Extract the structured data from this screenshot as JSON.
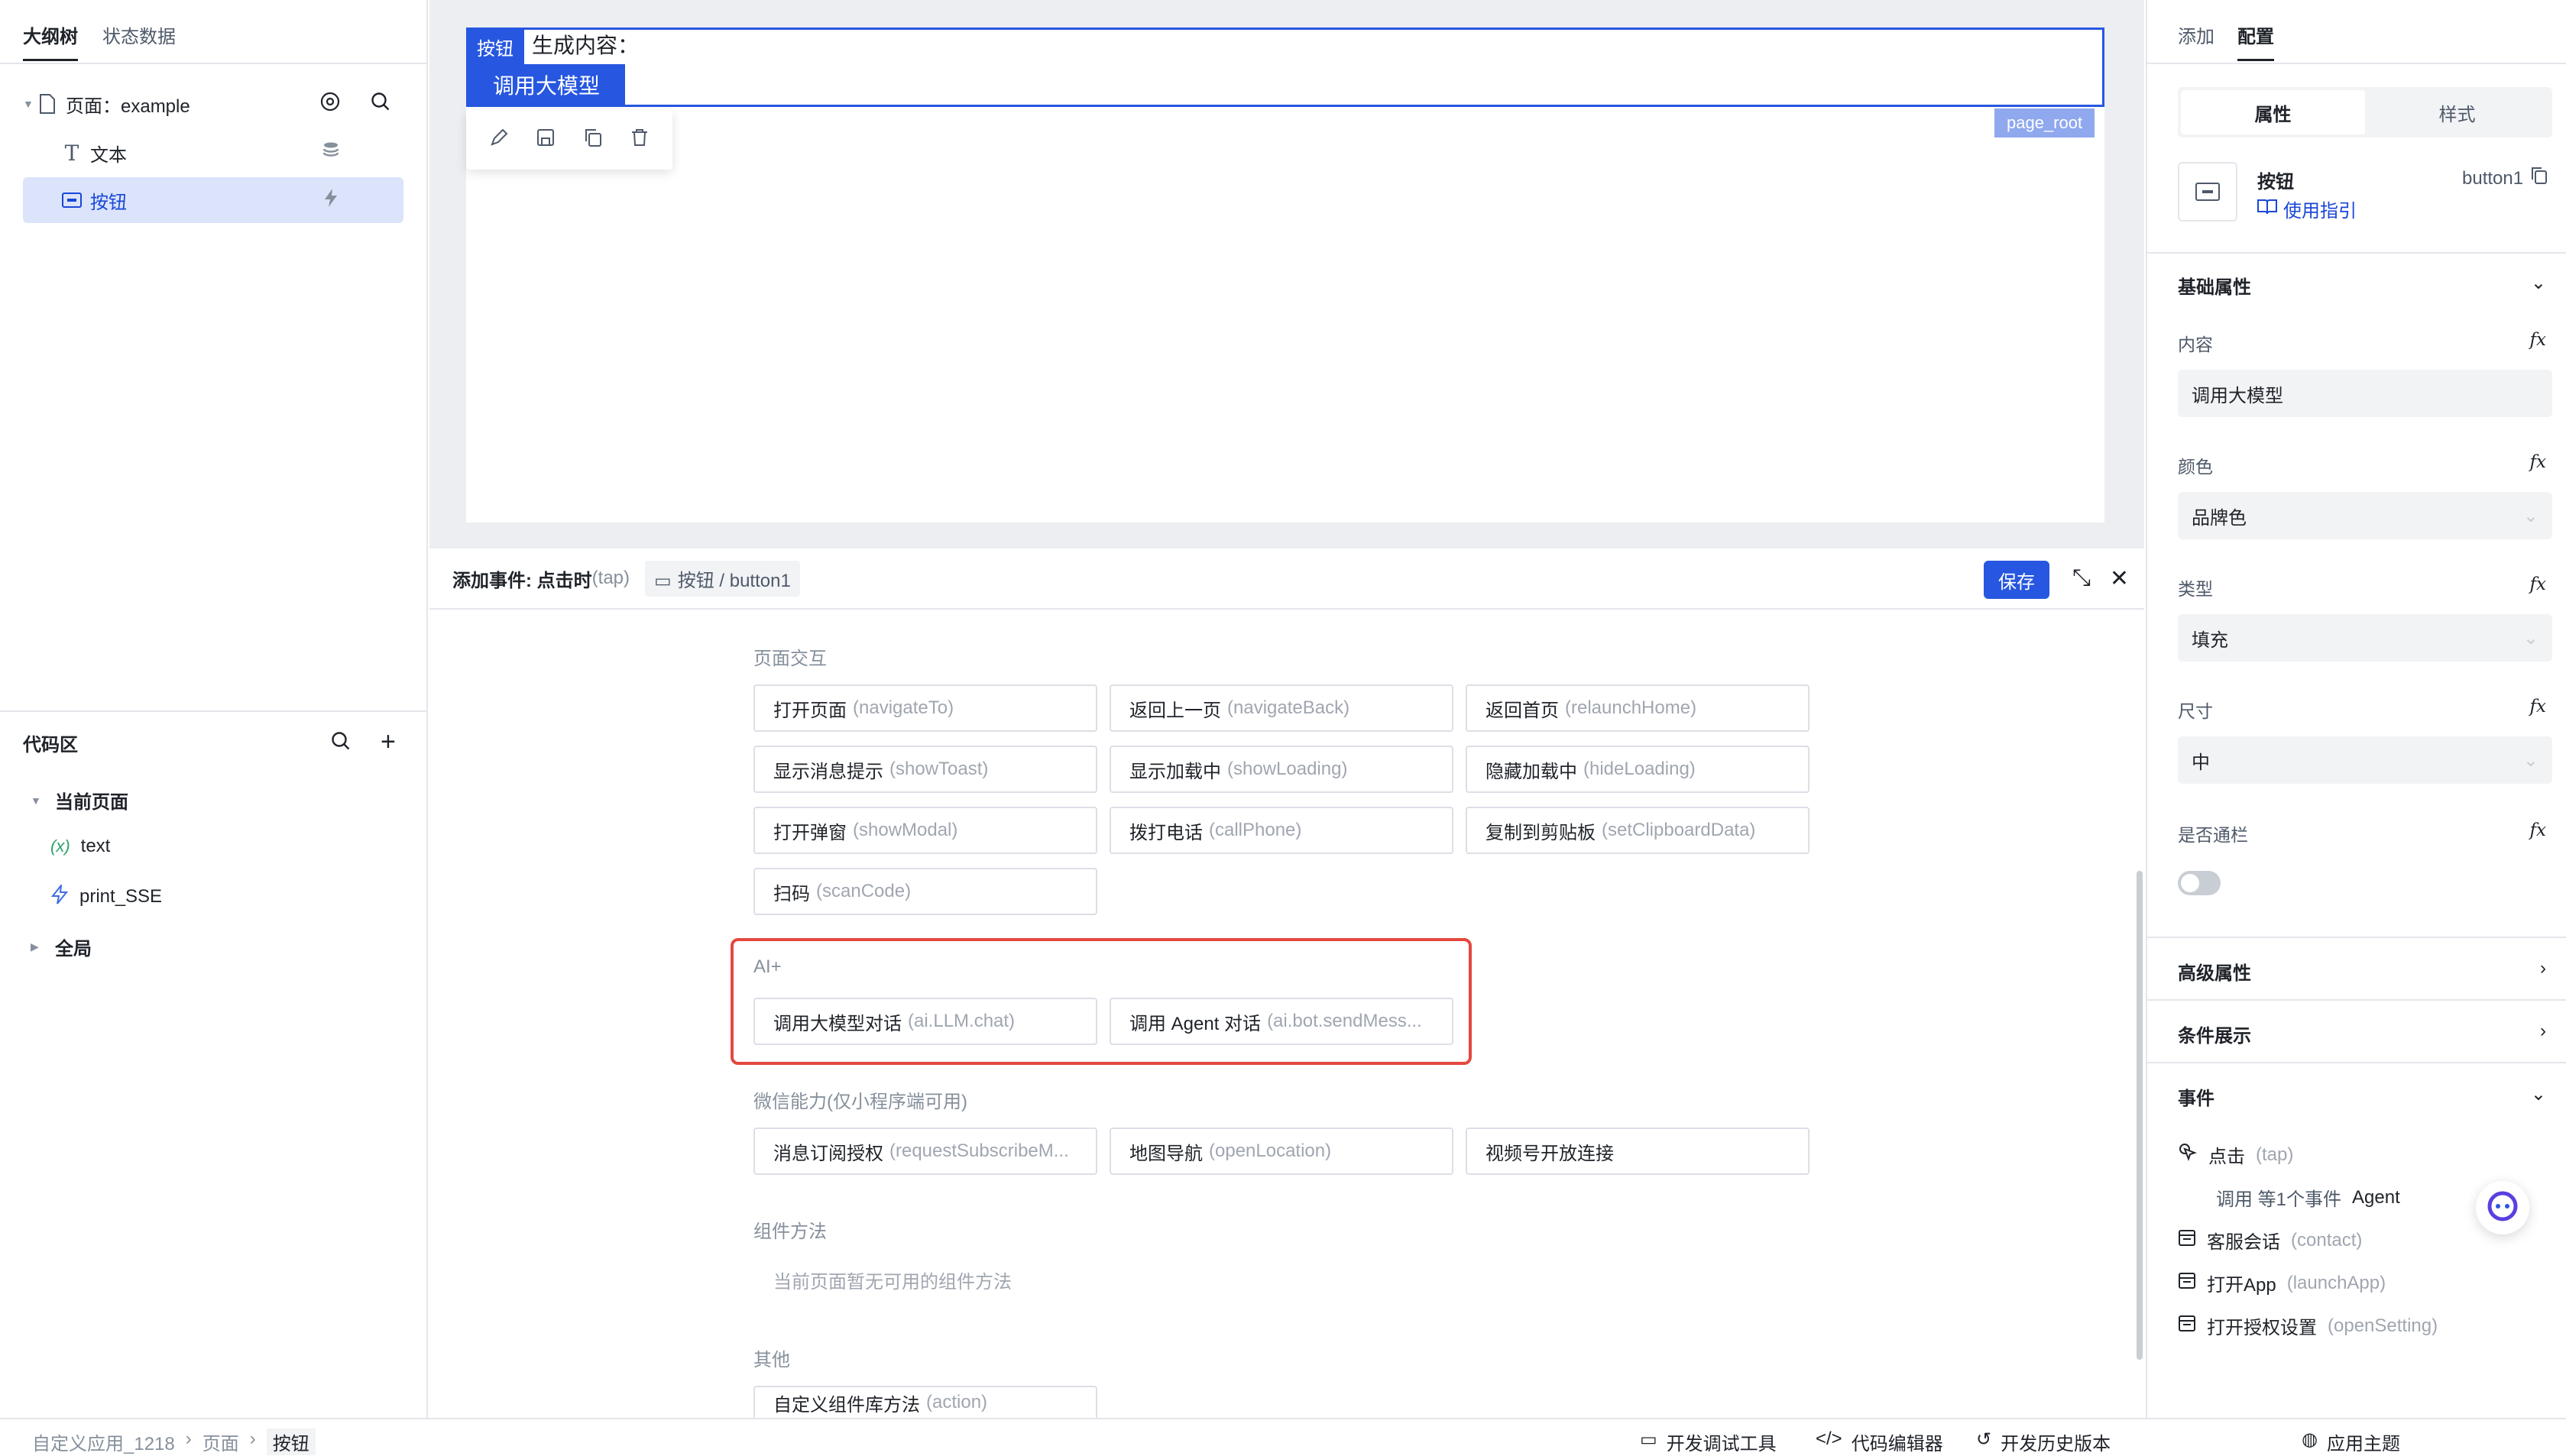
{
  "left_panel": {
    "tabs": [
      "大纲树",
      "状态数据"
    ],
    "tree": {
      "page": "页面：example",
      "text_node": "文本",
      "button_node": "按钮"
    },
    "code_area": {
      "title": "代码区",
      "current_page": "当前页面",
      "items": [
        "text",
        "print_SSE"
      ],
      "global": "全局"
    }
  },
  "canvas": {
    "chip_label": "按钮",
    "generated_text": "生成内容：",
    "button_text": "调用大模型",
    "page_root_label": "page_root"
  },
  "event_panel": {
    "title": "添加事件: 点击时",
    "title_en": "(tap)",
    "target": "按钮 / button1",
    "save": "保存",
    "sections": {
      "page_interaction": "页面交互",
      "ai": "AI+",
      "wechat": "微信能力(仅小程序端可用)",
      "component_methods": "组件方法",
      "other": "其他"
    },
    "page_actions": [
      {
        "cn": "打开页面",
        "en": "(navigateTo)"
      },
      {
        "cn": "返回上一页",
        "en": "(navigateBack)"
      },
      {
        "cn": "返回首页",
        "en": "(relaunchHome)"
      },
      {
        "cn": "显示消息提示",
        "en": "(showToast)"
      },
      {
        "cn": "显示加载中",
        "en": "(showLoading)"
      },
      {
        "cn": "隐藏加载中",
        "en": "(hideLoading)"
      },
      {
        "cn": "打开弹窗",
        "en": "(showModal)"
      },
      {
        "cn": "拨打电话",
        "en": "(callPhone)"
      },
      {
        "cn": "复制到剪贴板",
        "en": "(setClipboardData)"
      },
      {
        "cn": "扫码",
        "en": "(scanCode)"
      }
    ],
    "ai_actions": [
      {
        "cn": "调用大模型对话",
        "en": "(ai.LLM.chat)"
      },
      {
        "cn": "调用 Agent 对话",
        "en": "(ai.bot.sendMess..."
      }
    ],
    "wechat_actions": [
      {
        "cn": "消息订阅授权",
        "en": "(requestSubscribeM..."
      },
      {
        "cn": "地图导航",
        "en": "(openLocation)"
      },
      {
        "cn": "视频号开放连接",
        "en": ""
      }
    ],
    "component_empty": "当前页面暂无可用的组件方法",
    "other_actions": [
      {
        "cn": "自定义组件库方法",
        "en": "(action)"
      }
    ]
  },
  "right_panel": {
    "tabs": [
      "添加",
      "配置"
    ],
    "segments": [
      "属性",
      "样式"
    ],
    "component": {
      "name": "按钮",
      "guide": "使用指引",
      "id": "button1"
    },
    "basic_section": "基础属性",
    "fields": {
      "content_label": "内容",
      "content_value": "调用大模型",
      "color_label": "颜色",
      "color_value": "品牌色",
      "type_label": "类型",
      "type_value": "填充",
      "size_label": "尺寸",
      "size_value": "中",
      "block_label": "是否通栏"
    },
    "fx": "fx",
    "advanced_section": "高级属性",
    "condition_section": "条件展示",
    "events_section": "事件",
    "events": {
      "tap_cn": "点击",
      "tap_en": "(tap)",
      "tap_detail_1": "调用 等1个事件",
      "tap_detail_2": "Agent",
      "contact_cn": "客服会话",
      "contact_en": "(contact)",
      "launch_cn": "打开App",
      "launch_en": "(launchApp)",
      "setting_cn": "打开授权设置",
      "setting_en": "(openSetting)"
    }
  },
  "status_bar": {
    "crumbs": [
      "自定义应用_1218",
      "页面",
      "按钮"
    ],
    "dev_tools": "开发调试工具",
    "code_editor": "代码编辑器",
    "history": "开发历史版本",
    "theme": "应用主题"
  },
  "colors": {
    "brand": "#2757e0",
    "highlight_border": "#e4483f",
    "selected_row": "#dbe4fb"
  }
}
